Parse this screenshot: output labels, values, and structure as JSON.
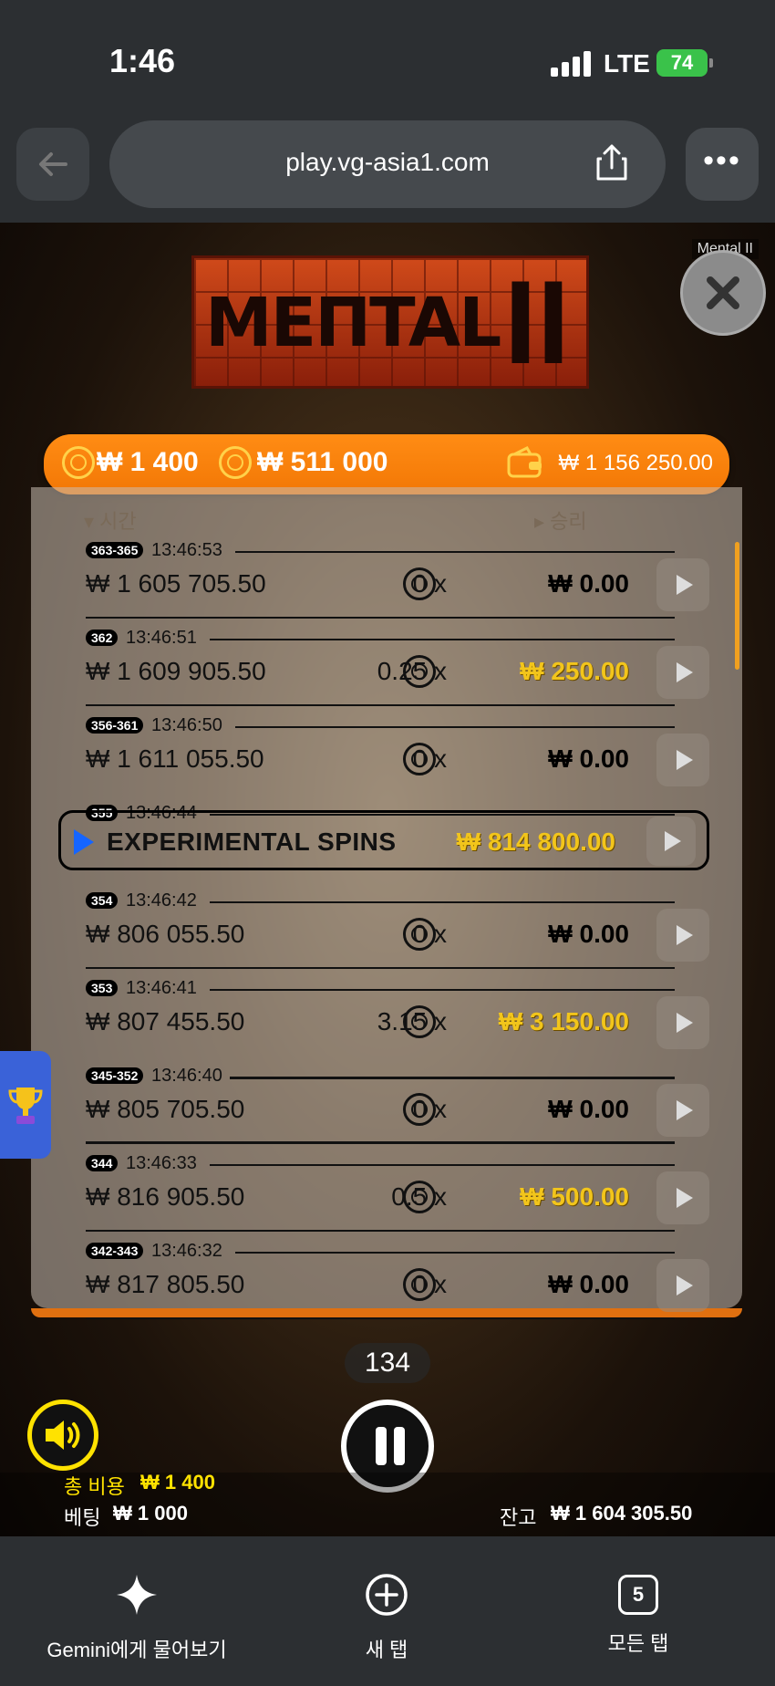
{
  "status": {
    "time": "1:46",
    "network": "LTE",
    "battery": "74"
  },
  "browser": {
    "url": "play.vg-asia1.com"
  },
  "game": {
    "tooltip": "Mental II",
    "logo_text": "MEΠTAL",
    "logo_numeral": "II",
    "top_bar": {
      "bet_cost": "₩ 1 400",
      "bet_value": "₩ 511 000",
      "balance": "₩ 1 156 250.00"
    },
    "columns": {
      "time": "▾ 시간",
      "win": "▸ 승리"
    },
    "rows": [
      {
        "tag": "363-365",
        "time": "13:46:53",
        "balance": "₩ 1 605 705.50",
        "mult": "0 x",
        "win": "₩ 0.00",
        "highlight": false
      },
      {
        "tag": "362",
        "time": "13:46:51",
        "balance": "₩ 1 609 905.50",
        "mult": "0.25 x",
        "win": "₩ 250.00",
        "highlight": true
      },
      {
        "tag": "356-361",
        "time": "13:46:50",
        "balance": "₩ 1 611 055.50",
        "mult": "0 x",
        "win": "₩ 0.00",
        "highlight": false
      },
      {
        "tag": "355",
        "time": "13:46:44"
      },
      {
        "tag": "354",
        "time": "13:46:42",
        "balance": "₩ 806 055.50",
        "mult": "0 x",
        "win": "₩ 0.00",
        "highlight": false
      },
      {
        "tag": "353",
        "time": "13:46:41",
        "balance": "₩ 807 455.50",
        "mult": "3.15 x",
        "win": "₩ 3 150.00",
        "highlight": true
      },
      {
        "tag": "345-352",
        "time": "13:46:40",
        "balance": "₩ 805 705.50",
        "mult": "0 x",
        "win": "₩ 0.00",
        "highlight": false
      },
      {
        "tag": "344",
        "time": "13:46:33",
        "balance": "₩ 816 905.50",
        "mult": "0.5 x",
        "win": "₩ 500.00",
        "highlight": true
      },
      {
        "tag": "342-343",
        "time": "13:46:32",
        "balance": "₩ 817 805.50",
        "mult": "0 x",
        "win": "₩ 0.00",
        "highlight": false
      }
    ],
    "feature": {
      "label": "EXPERIMENTAL SPINS",
      "win": "₩ 814 800.00"
    },
    "counter": "134",
    "footer": {
      "total_cost_label": "총 비용",
      "total_cost": "₩ 1 400",
      "bet_label": "베팅",
      "bet": "₩ 1 000",
      "balance_label": "잔고",
      "balance": "₩ 1 604 305.50"
    }
  },
  "tabbar": {
    "gemini": "Gemini에게 물어보기",
    "new_tab": "새 탭",
    "all_tabs": "모든 탭",
    "tab_count": "5"
  },
  "colors": {
    "accent": "#f27705",
    "gold": "#f2c51b",
    "sound_ring": "#ffe200"
  }
}
